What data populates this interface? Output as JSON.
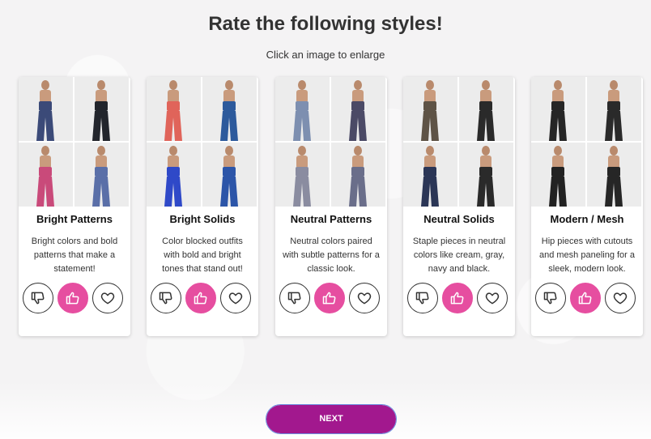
{
  "header": {
    "title": "Rate the following styles!",
    "subtitle": "Click an image to enlarge"
  },
  "colors": {
    "accent_pink": "#e64ea0",
    "next_button": "#a2188e"
  },
  "cards": [
    {
      "title": "Bright Patterns",
      "description": "Bright colors and bold patterns that make a statement!",
      "selected_rating": "like",
      "photo_palette": [
        "#3b4a78",
        "#22252c",
        "#c94a7a",
        "#5a6fa8"
      ]
    },
    {
      "title": "Bright Solids",
      "description": "Color blocked outfits with bold and bright tones that stand out!",
      "selected_rating": "like",
      "photo_palette": [
        "#e0645a",
        "#2d5a9c",
        "#2f49c8",
        "#2c55a8"
      ]
    },
    {
      "title": "Neutral Patterns",
      "description": "Neutral colors paired with subtle patterns for a classic look.",
      "selected_rating": "like",
      "photo_palette": [
        "#7d8fb0",
        "#4b4a66",
        "#8a8ca0",
        "#6a6e8a"
      ]
    },
    {
      "title": "Neutral Solids",
      "description": "Staple pieces in neutral colors like cream, gray, navy and black.",
      "selected_rating": "like",
      "photo_palette": [
        "#5e5346",
        "#2a2a2a",
        "#2b3656",
        "#2a2a2a"
      ]
    },
    {
      "title": "Modern / Mesh",
      "description": "Hip pieces with cutouts and mesh paneling for a sleek, modern look.",
      "selected_rating": "like",
      "photo_palette": [
        "#262626",
        "#2a2a2a",
        "#222222",
        "#262626"
      ]
    }
  ],
  "rating_icons": [
    "thumbs-down-icon",
    "thumbs-up-icon",
    "heart-icon"
  ],
  "footer": {
    "next_label": "NEXT"
  }
}
